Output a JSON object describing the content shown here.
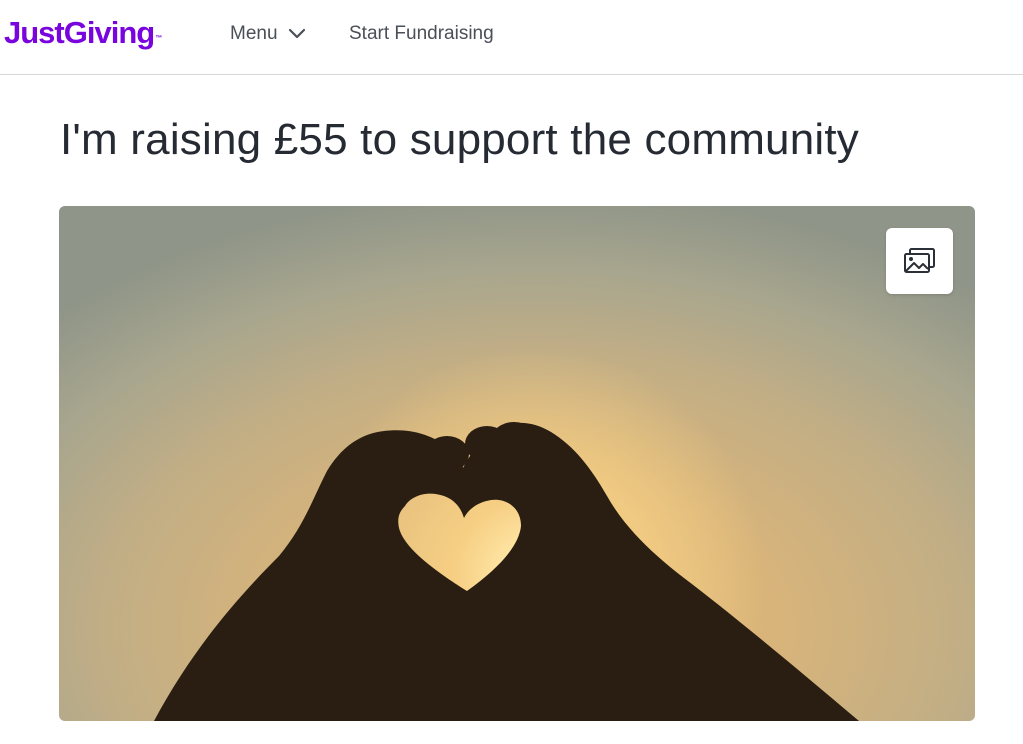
{
  "header": {
    "logo_text": "JustGiving",
    "logo_mark": "™",
    "menu_label": "Menu",
    "menu_icon": "chevron-down-icon",
    "start_label": "Start Fundraising"
  },
  "main": {
    "title": "I'm raising £55 to support the community",
    "hero": {
      "gallery_icon": "image-gallery-icon"
    }
  },
  "colors": {
    "brand": "#7a04dd",
    "title_text": "#252a33",
    "nav_text": "#4a4f58"
  }
}
